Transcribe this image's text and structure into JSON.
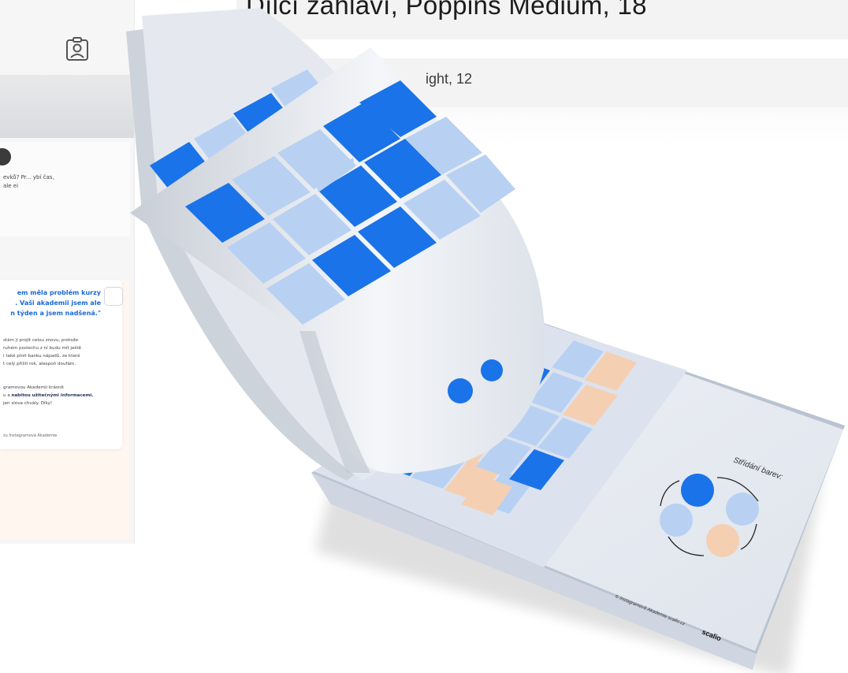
{
  "header": {
    "title": "Dílčí záhlaví, Poppins Medium, 18",
    "subtitle": "ight, 12"
  },
  "sidebar": {
    "post_snippet": "evků? Pr... ybí čas, ale ei"
  },
  "review": {
    "quote": "em měla problém kurzy\n. Vaši akademii jsem ale\nn týden a jsem nadšená.\"",
    "body": "stám ji projít celou znovu, protože\nruhém poslechu z ní budu mít ještě\ni také plnit banku nápadů, ze které\nt celý příští rok, alespoň doufám.",
    "body2_prefix": "gramovou Akademii krásně",
    "body2_highlight_pre": "u a ",
    "body2_highlight": "nabitou užitečnými informacemi.",
    "body2_suffix": "jen slova chvály. Díky!",
    "signature": "zu Instagramová Akademie"
  },
  "booklet": {
    "color_section_label": "Střídání barev:",
    "footer_text": "© Instagramová Akademie scalio.cz",
    "brand": "scalio",
    "colors": {
      "blue": "#1a73e8",
      "light_blue": "#b8d1f3",
      "peach": "#f5cfb2",
      "page": "#e4e8ef"
    }
  },
  "icons": {
    "profile": "user-card-icon",
    "checkbox": "checkbox-icon"
  }
}
